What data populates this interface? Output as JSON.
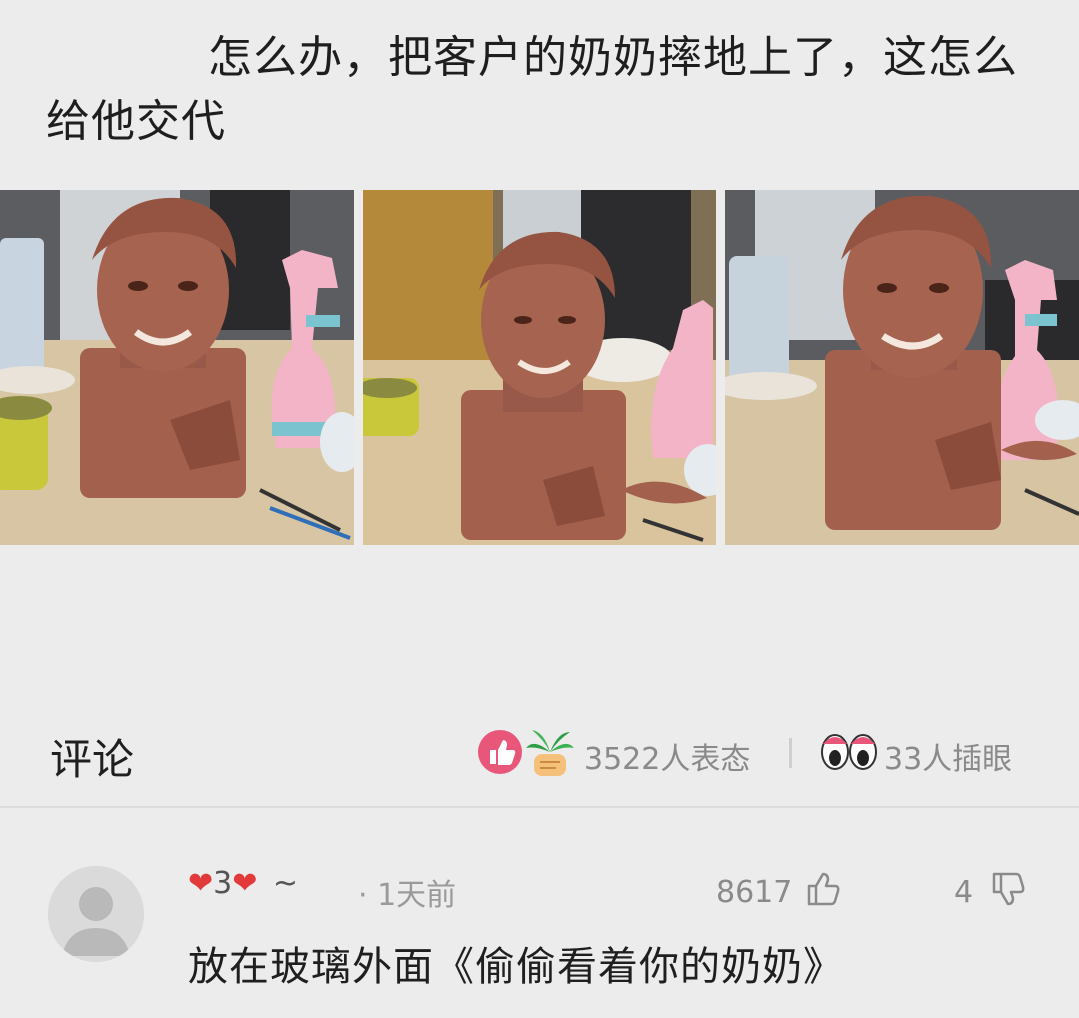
{
  "post": {
    "title": "怎么办，把客户的奶奶摔地上了，这怎么给他交代"
  },
  "photos": {
    "items": [
      "clay-bust-photo-1",
      "clay-bust-photo-2",
      "clay-bust-photo-3"
    ]
  },
  "comments_header": {
    "title": "评论",
    "reactions_label": "3522人表态",
    "eye_label": "33人插眼"
  },
  "comment": {
    "username_heart_count": "3",
    "username_suffix": "~",
    "time": "· 1天前",
    "likes": "8617",
    "dislikes": "4",
    "text": "放在玻璃外面《偷偷看着你的奶奶》"
  },
  "colors": {
    "background": "#ececec",
    "clay": "#a2604d",
    "heart": "#e23a3a",
    "like_badge": "#e8577a"
  },
  "icons": [
    "like-badge-icon",
    "palm-tree-icon",
    "eyes-icon",
    "heart-icon",
    "thumbs-up-icon",
    "thumbs-down-icon",
    "avatar-placeholder-icon"
  ]
}
